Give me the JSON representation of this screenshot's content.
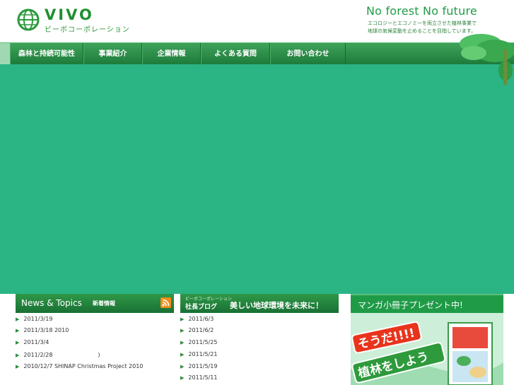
{
  "header": {
    "logo_title": "VIVO",
    "logo_sub": "ビーボコーポレーション",
    "slogan": "No forest No future",
    "tagline_line1": "エコロジーとエコノミーを両立させた植林事業で",
    "tagline_line2": "地球の気候変動を止めることを目指しています。"
  },
  "nav": {
    "items": [
      {
        "label": "森林と持続可能性"
      },
      {
        "label": "事業紹介"
      },
      {
        "label": "企業情報"
      },
      {
        "label": "よくある質問"
      },
      {
        "label": "お問い合わせ"
      }
    ]
  },
  "news": {
    "title": "News & Topics",
    "sub": "新着情報",
    "items": [
      {
        "text": "2011/3/19"
      },
      {
        "text": "2011/3/18 2010"
      },
      {
        "text": "2011/3/4"
      },
      {
        "text": "2011/2/28　　　　　　　　)"
      },
      {
        "text": "2010/12/7 SHINAP Christmas Project 2010"
      }
    ]
  },
  "blog": {
    "sub": "ビーボコーポレーション",
    "title": "社長ブログ",
    "tag": "美しい地球環境を未来に！",
    "items": [
      {
        "text": "2011/6/3"
      },
      {
        "text": "2011/6/2"
      },
      {
        "text": "2011/5/25"
      },
      {
        "text": "2011/5/21"
      },
      {
        "text": "2011/5/19"
      },
      {
        "text": "2011/5/11"
      }
    ]
  },
  "manga": {
    "title": "マンガ小冊子プレゼント中!",
    "art_text_1": "そうだ!!!!",
    "art_text_2": "植林をしよう"
  },
  "colors": {
    "hero": "#2bb484",
    "brand_green": "#1f8f2f",
    "nav_dark": "#1d7b3a"
  }
}
